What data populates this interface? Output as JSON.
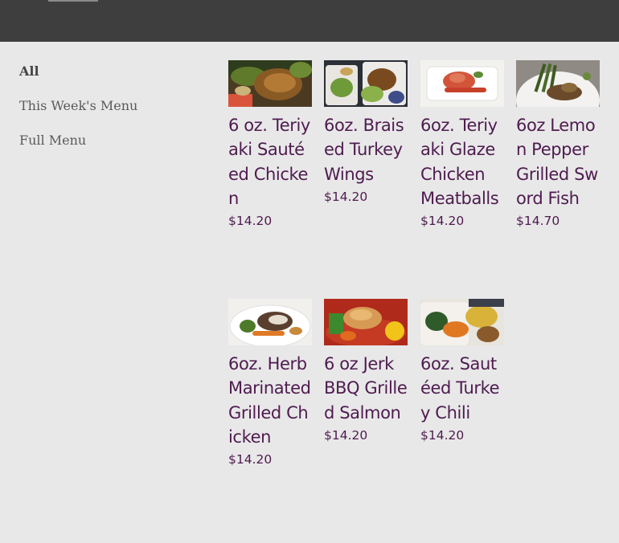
{
  "sidebar": {
    "items": [
      {
        "label": "All",
        "active": true
      },
      {
        "label": "This Week's Menu",
        "active": false
      },
      {
        "label": "Full Menu",
        "active": false
      }
    ]
  },
  "products": [
    {
      "title": "6 oz. Teriyaki Sautéed Chicken",
      "price": "$14.20",
      "image": "teriyaki-chicken-photo"
    },
    {
      "title": "6oz. Braised Turkey Wings",
      "price": "$14.20",
      "image": "turkey-wings-photo"
    },
    {
      "title": "6oz. Teriyaki Glaze Chicken Meatballs",
      "price": "$14.20",
      "image": "chicken-meatballs-photo"
    },
    {
      "title": "6oz Lemon Pepper Grilled Sword Fish",
      "price": "$14.70",
      "image": "sword-fish-photo"
    },
    {
      "title": "6oz. Herb Marinated Grilled Chicken",
      "price": "$14.20",
      "image": "herb-chicken-photo"
    },
    {
      "title": "6 oz Jerk BBQ Grilled Salmon",
      "price": "$14.20",
      "image": "jerk-salmon-photo"
    },
    {
      "title": "6oz. Sautéed Turkey Chili",
      "price": "$14.20",
      "image": "turkey-chili-photo"
    }
  ],
  "colors": {
    "header": "#3e3e3e",
    "background": "#e8e8e8",
    "title": "#4e1b4f"
  }
}
